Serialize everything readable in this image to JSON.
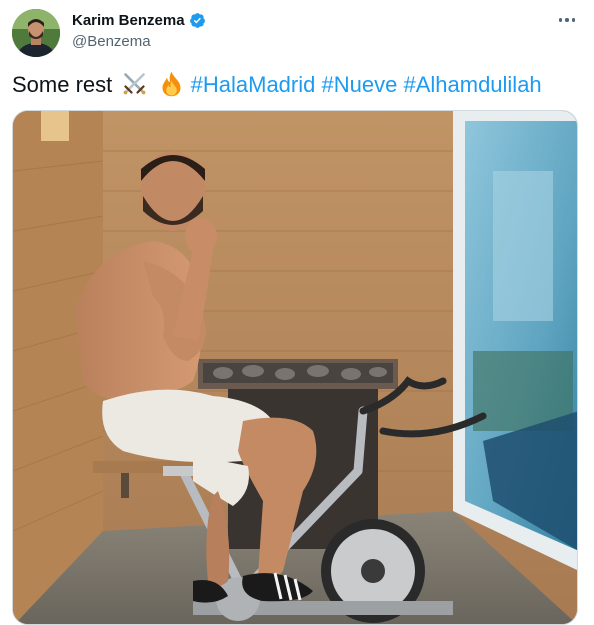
{
  "author": {
    "display_name": "Karim Benzema",
    "handle": "@Benzema",
    "verified": true,
    "avatar_icon": "profile-avatar"
  },
  "more_icon": "more-horizontal-icon",
  "tweet": {
    "text_plain": "Some rest",
    "emojis": [
      "crossed-swords-icon",
      "fire-icon"
    ],
    "hashtags": [
      "#HalaMadrid",
      "#Nueve",
      "#Alhamdulilah"
    ]
  },
  "colors": {
    "link": "#1d9bf0",
    "text": "#0f1419",
    "secondary": "#536471",
    "verified": "#1d9bf0"
  },
  "media": {
    "type": "photo",
    "icon": "sauna-exercise-bike-photo"
  }
}
